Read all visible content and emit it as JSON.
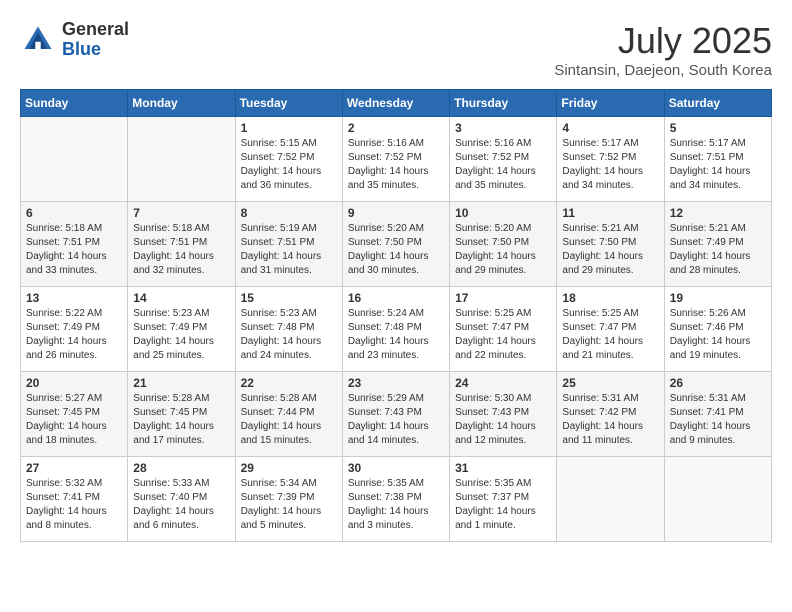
{
  "header": {
    "logo_general": "General",
    "logo_blue": "Blue",
    "month_title": "July 2025",
    "location": "Sintansin, Daejeon, South Korea"
  },
  "weekdays": [
    "Sunday",
    "Monday",
    "Tuesday",
    "Wednesday",
    "Thursday",
    "Friday",
    "Saturday"
  ],
  "weeks": [
    [
      {
        "day": "",
        "info": ""
      },
      {
        "day": "",
        "info": ""
      },
      {
        "day": "1",
        "info": "Sunrise: 5:15 AM\nSunset: 7:52 PM\nDaylight: 14 hours and 36 minutes."
      },
      {
        "day": "2",
        "info": "Sunrise: 5:16 AM\nSunset: 7:52 PM\nDaylight: 14 hours and 35 minutes."
      },
      {
        "day": "3",
        "info": "Sunrise: 5:16 AM\nSunset: 7:52 PM\nDaylight: 14 hours and 35 minutes."
      },
      {
        "day": "4",
        "info": "Sunrise: 5:17 AM\nSunset: 7:52 PM\nDaylight: 14 hours and 34 minutes."
      },
      {
        "day": "5",
        "info": "Sunrise: 5:17 AM\nSunset: 7:51 PM\nDaylight: 14 hours and 34 minutes."
      }
    ],
    [
      {
        "day": "6",
        "info": "Sunrise: 5:18 AM\nSunset: 7:51 PM\nDaylight: 14 hours and 33 minutes."
      },
      {
        "day": "7",
        "info": "Sunrise: 5:18 AM\nSunset: 7:51 PM\nDaylight: 14 hours and 32 minutes."
      },
      {
        "day": "8",
        "info": "Sunrise: 5:19 AM\nSunset: 7:51 PM\nDaylight: 14 hours and 31 minutes."
      },
      {
        "day": "9",
        "info": "Sunrise: 5:20 AM\nSunset: 7:50 PM\nDaylight: 14 hours and 30 minutes."
      },
      {
        "day": "10",
        "info": "Sunrise: 5:20 AM\nSunset: 7:50 PM\nDaylight: 14 hours and 29 minutes."
      },
      {
        "day": "11",
        "info": "Sunrise: 5:21 AM\nSunset: 7:50 PM\nDaylight: 14 hours and 29 minutes."
      },
      {
        "day": "12",
        "info": "Sunrise: 5:21 AM\nSunset: 7:49 PM\nDaylight: 14 hours and 28 minutes."
      }
    ],
    [
      {
        "day": "13",
        "info": "Sunrise: 5:22 AM\nSunset: 7:49 PM\nDaylight: 14 hours and 26 minutes."
      },
      {
        "day": "14",
        "info": "Sunrise: 5:23 AM\nSunset: 7:49 PM\nDaylight: 14 hours and 25 minutes."
      },
      {
        "day": "15",
        "info": "Sunrise: 5:23 AM\nSunset: 7:48 PM\nDaylight: 14 hours and 24 minutes."
      },
      {
        "day": "16",
        "info": "Sunrise: 5:24 AM\nSunset: 7:48 PM\nDaylight: 14 hours and 23 minutes."
      },
      {
        "day": "17",
        "info": "Sunrise: 5:25 AM\nSunset: 7:47 PM\nDaylight: 14 hours and 22 minutes."
      },
      {
        "day": "18",
        "info": "Sunrise: 5:25 AM\nSunset: 7:47 PM\nDaylight: 14 hours and 21 minutes."
      },
      {
        "day": "19",
        "info": "Sunrise: 5:26 AM\nSunset: 7:46 PM\nDaylight: 14 hours and 19 minutes."
      }
    ],
    [
      {
        "day": "20",
        "info": "Sunrise: 5:27 AM\nSunset: 7:45 PM\nDaylight: 14 hours and 18 minutes."
      },
      {
        "day": "21",
        "info": "Sunrise: 5:28 AM\nSunset: 7:45 PM\nDaylight: 14 hours and 17 minutes."
      },
      {
        "day": "22",
        "info": "Sunrise: 5:28 AM\nSunset: 7:44 PM\nDaylight: 14 hours and 15 minutes."
      },
      {
        "day": "23",
        "info": "Sunrise: 5:29 AM\nSunset: 7:43 PM\nDaylight: 14 hours and 14 minutes."
      },
      {
        "day": "24",
        "info": "Sunrise: 5:30 AM\nSunset: 7:43 PM\nDaylight: 14 hours and 12 minutes."
      },
      {
        "day": "25",
        "info": "Sunrise: 5:31 AM\nSunset: 7:42 PM\nDaylight: 14 hours and 11 minutes."
      },
      {
        "day": "26",
        "info": "Sunrise: 5:31 AM\nSunset: 7:41 PM\nDaylight: 14 hours and 9 minutes."
      }
    ],
    [
      {
        "day": "27",
        "info": "Sunrise: 5:32 AM\nSunset: 7:41 PM\nDaylight: 14 hours and 8 minutes."
      },
      {
        "day": "28",
        "info": "Sunrise: 5:33 AM\nSunset: 7:40 PM\nDaylight: 14 hours and 6 minutes."
      },
      {
        "day": "29",
        "info": "Sunrise: 5:34 AM\nSunset: 7:39 PM\nDaylight: 14 hours and 5 minutes."
      },
      {
        "day": "30",
        "info": "Sunrise: 5:35 AM\nSunset: 7:38 PM\nDaylight: 14 hours and 3 minutes."
      },
      {
        "day": "31",
        "info": "Sunrise: 5:35 AM\nSunset: 7:37 PM\nDaylight: 14 hours and 1 minute."
      },
      {
        "day": "",
        "info": ""
      },
      {
        "day": "",
        "info": ""
      }
    ]
  ]
}
